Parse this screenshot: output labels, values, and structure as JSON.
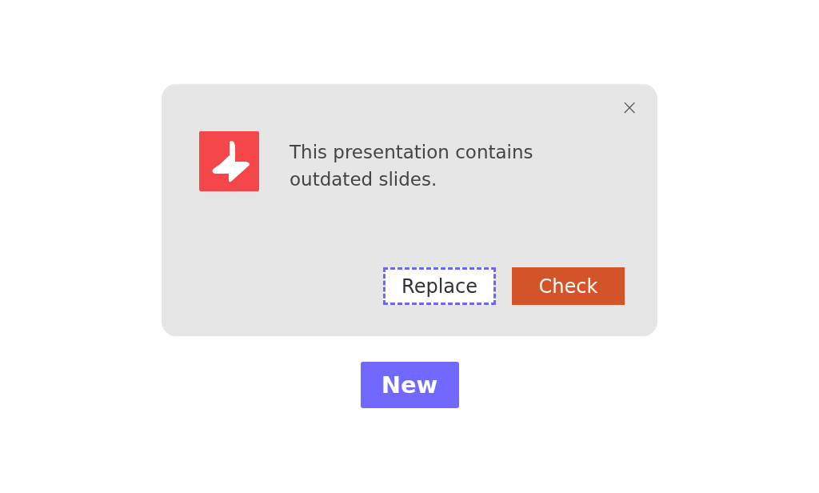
{
  "dialog": {
    "message": "This presentation contains outdated slides.",
    "close": "×",
    "buttons": [
      {
        "label": "Replace",
        "kind": "secondary",
        "focused": true
      },
      {
        "label": "Check",
        "kind": "primary",
        "focused": false
      }
    ]
  },
  "new_button": {
    "label": "New"
  }
}
